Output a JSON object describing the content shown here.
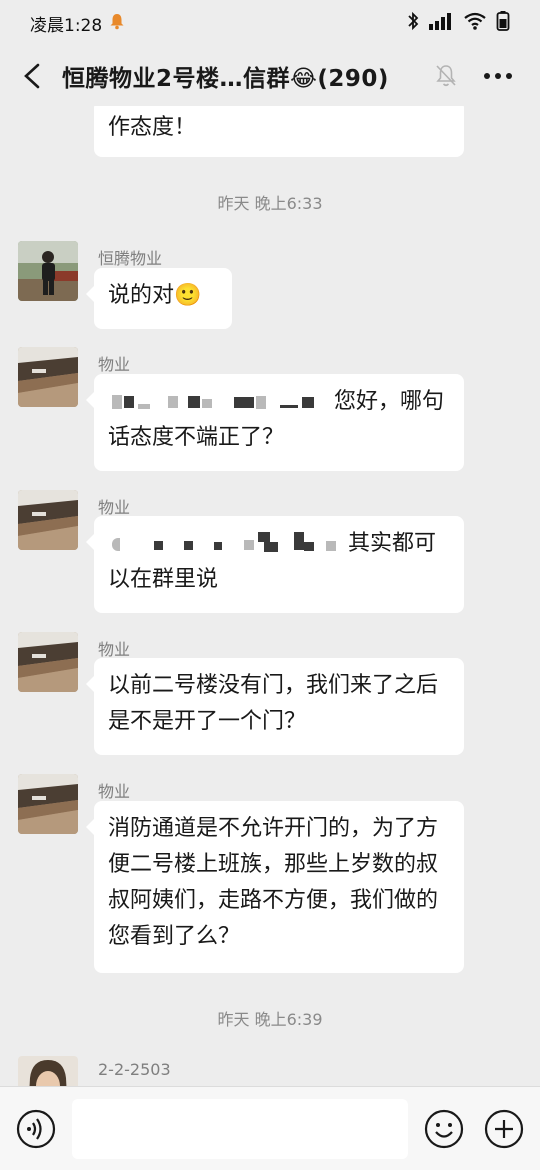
{
  "status_bar": {
    "time": "凌晨1:28"
  },
  "header": {
    "title": "恒腾物业2号楼…信群😂(290)"
  },
  "messages": {
    "m0": {
      "text": "作态度！"
    },
    "t1": "昨天 晚上6:33",
    "m1": {
      "sender": "恒腾物业",
      "text": "说的对🙂"
    },
    "m2": {
      "sender": "物业",
      "text_tail": "您好，哪句",
      "text_line2": "话态度不端正了？"
    },
    "m3": {
      "sender": "物业",
      "text_tail": "其实都可",
      "text_line2": "以在群里说"
    },
    "m4": {
      "sender": "物业",
      "text": "以前二号楼没有门，我们来了之后是不是开了一个门？"
    },
    "m5": {
      "sender": "物业",
      "text": "消防通道是不允许开门的，为了方便二号楼上班族，那些上岁数的叔叔阿姨们，走路不方便，我们做的您看到了么？"
    },
    "t2": "昨天 晚上6:39",
    "m6": {
      "sender": "2-2-2503"
    }
  },
  "input": {
    "placeholder": ""
  },
  "colors": {
    "background": "#ededed",
    "bubble": "#ffffff",
    "timestamp": "#8a8a8a",
    "sender": "#7f7f7f"
  }
}
